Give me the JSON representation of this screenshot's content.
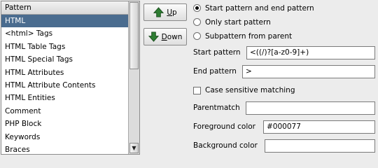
{
  "list": {
    "header": "Pattern",
    "items": [
      {
        "label": "HTML",
        "selected": true
      },
      {
        "label": "<html> Tags",
        "selected": false
      },
      {
        "label": "HTML Table Tags",
        "selected": false
      },
      {
        "label": "HTML Special Tags",
        "selected": false
      },
      {
        "label": "HTML Attributes",
        "selected": false
      },
      {
        "label": "HTML Attribute Contents",
        "selected": false
      },
      {
        "label": "HTML Entities",
        "selected": false
      },
      {
        "label": "Comment",
        "selected": false
      },
      {
        "label": "PHP Block",
        "selected": false
      },
      {
        "label": "Keywords",
        "selected": false
      },
      {
        "label": "Braces",
        "selected": false
      }
    ]
  },
  "buttons": {
    "up_mnemonic": "U",
    "up_rest": "p",
    "down_mnemonic": "D",
    "down_rest": "own"
  },
  "radios": {
    "start_end": {
      "label": "Start pattern and end pattern",
      "checked": true
    },
    "only_start": {
      "label": "Only start pattern",
      "checked": false
    },
    "subpattern": {
      "label": "Subpattern from parent",
      "checked": false
    }
  },
  "fields": {
    "start_pattern": {
      "label": "Start pattern",
      "value": "<((/)?[a-z0-9]+)"
    },
    "end_pattern": {
      "label": "End pattern",
      "value": ">"
    },
    "case_sensitive": {
      "label": "Case sensitive matching",
      "checked": false
    },
    "parentmatch": {
      "label": "Parentmatch",
      "value": ""
    },
    "foreground": {
      "label": "Foreground color",
      "value": "#000077"
    },
    "background": {
      "label": "Background color",
      "value": ""
    }
  },
  "colors": {
    "selection": "#4a6c8f",
    "arrow_green": "#2e7d32"
  }
}
